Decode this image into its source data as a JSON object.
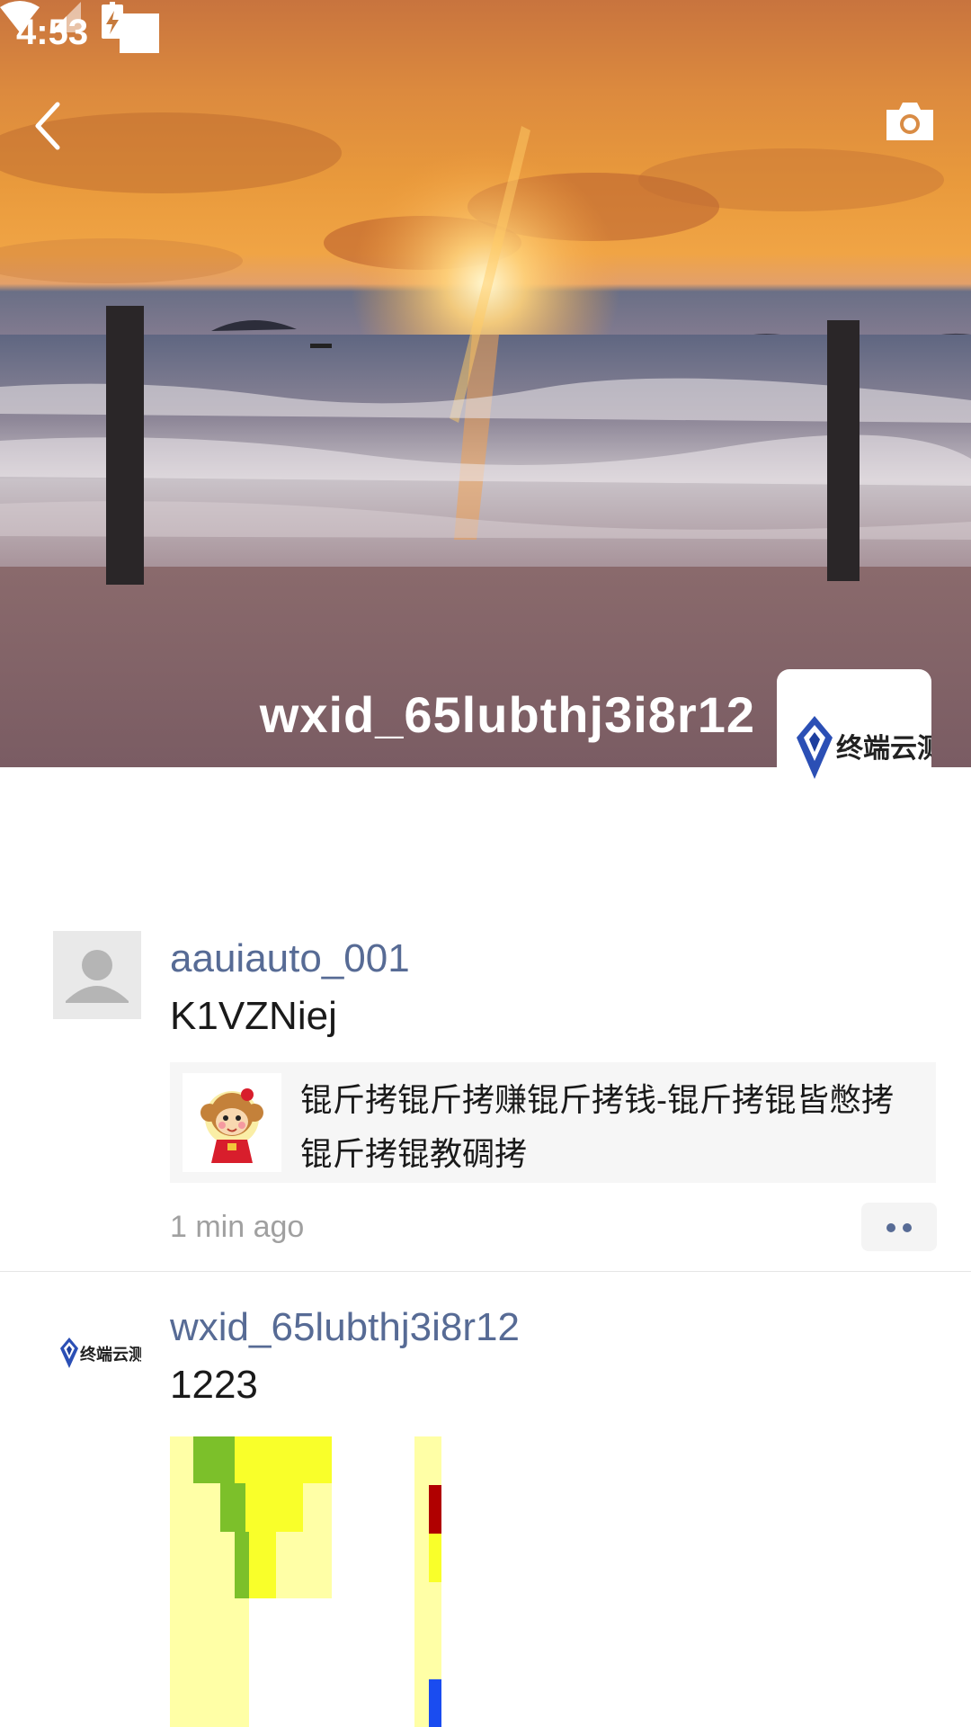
{
  "status_bar": {
    "time": "4:53",
    "icons": [
      "wifi-icon",
      "signal-icon",
      "battery-charging-icon"
    ]
  },
  "header": {
    "back_icon": "back-chevron-icon",
    "camera_icon": "camera-icon",
    "profile_name": "wxid_65lubthj3i8r12",
    "avatar_logo_text": "终端云测"
  },
  "posts": [
    {
      "author": "aauiauto_001",
      "avatar": "default-person-icon",
      "text": "K1VZNiej",
      "link": {
        "title": "锟斤拷锟斤拷赚锟斤拷钱-锟斤拷锟皆憋拷锟斤拷锟教碉拷",
        "thumb": "monkey-sticker-image"
      },
      "time": "1 min ago",
      "more_icon": "more-dots-icon"
    },
    {
      "author": "wxid_65lubthj3i8r12",
      "avatar_logo_text": "终端云测",
      "text": "1223",
      "image": "pixel-art-image"
    }
  ],
  "colors": {
    "author_link": "#576b95",
    "timestamp": "#a0a0a0",
    "card_bg": "#f6f6f6"
  }
}
